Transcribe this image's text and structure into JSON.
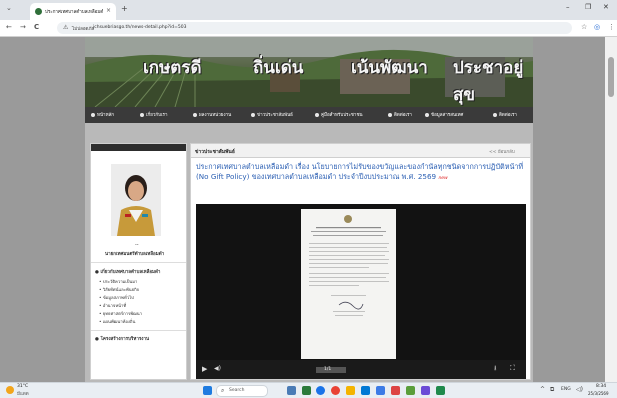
{
  "browser": {
    "tab_title": "ประกาศเทศบาลตำบลเหลือมดำ",
    "new_tab": "+",
    "tab_close": "×",
    "back": "←",
    "forward": "→",
    "reload": "C",
    "security": "ไม่ปลอดภัย",
    "url": "jchsuebriasgo.th/news-detail.php?id=503",
    "minimize": "–",
    "maximize": "❐",
    "close": "✕",
    "star": "☆",
    "profile": "◎",
    "menu": "⋮"
  },
  "banner": {
    "words": [
      "เกษตรดี",
      "ถิ่นเด่น",
      "เน้นพัฒนา",
      "ประชาอยู่สุข"
    ]
  },
  "menu": {
    "items": [
      "หน้าหลัก",
      "เกี่ยวกับเรา",
      "ผลงานหน่วยงาน",
      "ข่าวประชาสัมพันธ์",
      "คู่มือสำหรับประชาชน",
      "ติดต่อเรา",
      "ข้อมูลสารสนเทศ",
      "ติดต่อเรา"
    ]
  },
  "sidebar": {
    "name": "นายกเทศมนตรีตำบลเหลือมดำ",
    "dash": "--",
    "section_title": "เกี่ยวกับเทศบาลตำบลเหลือมดำ",
    "links": [
      "ประวัติความเป็นมา",
      "วิสัยทัศน์และพันธกิจ",
      "ข้อมูลสภาพทั่วไป",
      "อำนาจหน้าที่",
      "ยุทธศาสตร์การพัฒนา",
      "แผนพัฒนาท้องถิ่น"
    ],
    "section2_title": "โครงสร้างการบริหารงาน"
  },
  "main": {
    "header": "ข่าวประชาสัมพันธ์",
    "back_link": "<< ย้อนกลับ",
    "title": "ประกาศเทศบาลตำบลเหลือมดำ เรื่อง นโยบายการไม่รับของขวัญและของกำนัลทุกชนิดจากการปฏิบัติหน้าที่ (No Gift Policy) ของเทศบาลตำบลเหลือมดำ ประจำปีงบประมาณ พ.ศ. 2569",
    "badge": "new"
  },
  "player": {
    "play": "▶",
    "volume": "◀)",
    "pages": "1/1",
    "download": "⭳",
    "fullscreen": "⛶"
  },
  "taskbar": {
    "weather_temp": "31°C",
    "weather_cond": "มีแดด",
    "search": "Search",
    "lang": "ENG",
    "time": "8:34",
    "date": "25/3/2569"
  }
}
